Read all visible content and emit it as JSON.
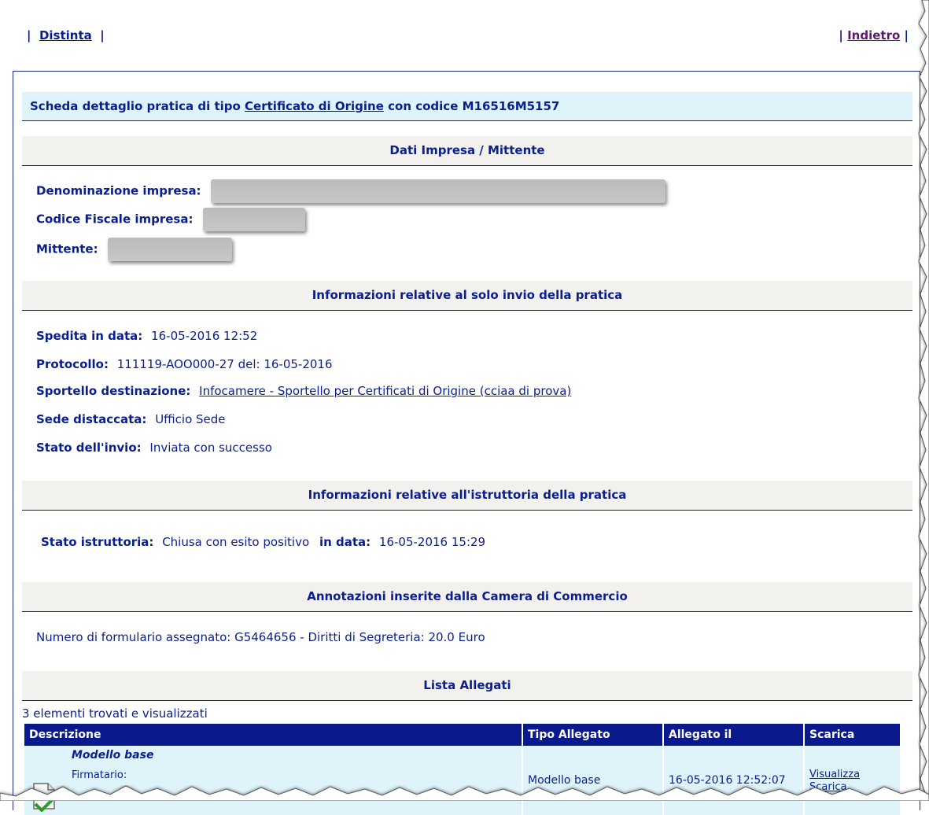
{
  "nav": {
    "left_link": "Distinta",
    "right_link": "Indietro",
    "sep": "|"
  },
  "title": {
    "prefix": "Scheda dettaglio pratica di tipo",
    "type_link": "Certificato di Origine",
    "suffix": "con codice M16516M5157"
  },
  "impresa": {
    "header": "Dati Impresa / Mittente",
    "denominazione_label": "Denominazione impresa:",
    "codice_fiscale_label": "Codice Fiscale impresa:",
    "mittente_label": "Mittente:"
  },
  "invio": {
    "header": "Informazioni relative al solo invio della pratica",
    "spedita_label": "Spedita in data:",
    "spedita_value": "16-05-2016 12:52",
    "protocollo_label": "Protocollo:",
    "protocollo_value": "111119-AOO000-27  del: 16-05-2016",
    "sportello_label": "Sportello destinazione:",
    "sportello_value": "Infocamere - Sportello per Certificati di Origine (cciaa di prova)",
    "sede_label": "Sede distaccata:",
    "sede_value": "Ufficio Sede",
    "stato_label": "Stato dell'invio:",
    "stato_value": "Inviata con successo"
  },
  "istruttoria": {
    "header": "Informazioni relative all'istruttoria della pratica",
    "stato_label": "Stato istruttoria:",
    "stato_value": "Chiusa con esito positivo",
    "data_label": "in data:",
    "data_value": "16-05-2016 15:29"
  },
  "annotazioni": {
    "header": "Annotazioni inserite dalla Camera di Commercio",
    "text": "Numero di formulario assegnato: G5464656 - Diritti di Segreteria: 20.0 Euro"
  },
  "allegati": {
    "header": "Lista Allegati",
    "count_text": "3 elementi trovati e visualizzati",
    "columns": [
      "Descrizione",
      "Tipo Allegato",
      "Allegato il",
      "Scarica"
    ],
    "rows": [
      {
        "descrizione": "Modello base",
        "firmatario_label": "Firmatario:",
        "tipo": "Modello base",
        "data": "16-05-2016 12:52:07",
        "visualizza": "Visualizza",
        "scarica": "Scarica"
      }
    ]
  },
  "colors": {
    "text": "#0a1f8f",
    "title_bg": "#dff3fb",
    "section_bg": "#f3f1ee",
    "table_head": "#0a1a8c"
  }
}
